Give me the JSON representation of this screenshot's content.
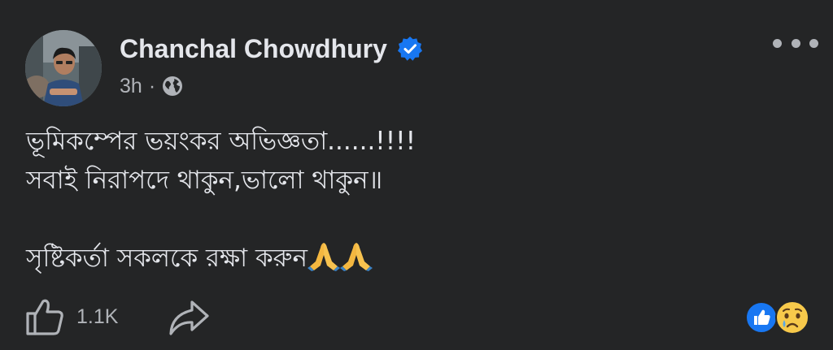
{
  "author": {
    "name": "Chanchal Chowdhury",
    "verified_icon": "verified-badge-icon"
  },
  "meta": {
    "time": "3h",
    "separator": "·",
    "audience_icon": "globe-icon"
  },
  "more_icon": "more-options-icon",
  "post": {
    "line1": "ভূমিকম্পের ভয়ংকর অভিজ্ঞতা......!!!!",
    "line2": "সবাই নিরাপদে থাকুন,ভালো থাকুন॥",
    "line3": "সৃষ্টিকর্তা সকলকে রক্ষা করুন",
    "line3_emoji": "folded-hands-emoji"
  },
  "footer": {
    "like_icon": "thumbs-up-outline-icon",
    "like_count": "1.1K",
    "share_icon": "share-arrow-icon",
    "reactions": [
      "like-reaction-icon",
      "sad-reaction-icon"
    ]
  },
  "colors": {
    "background": "#242526",
    "text_primary": "#e4e6eb",
    "text_secondary": "#b0b3b8",
    "verified_blue": "#1877f2"
  }
}
